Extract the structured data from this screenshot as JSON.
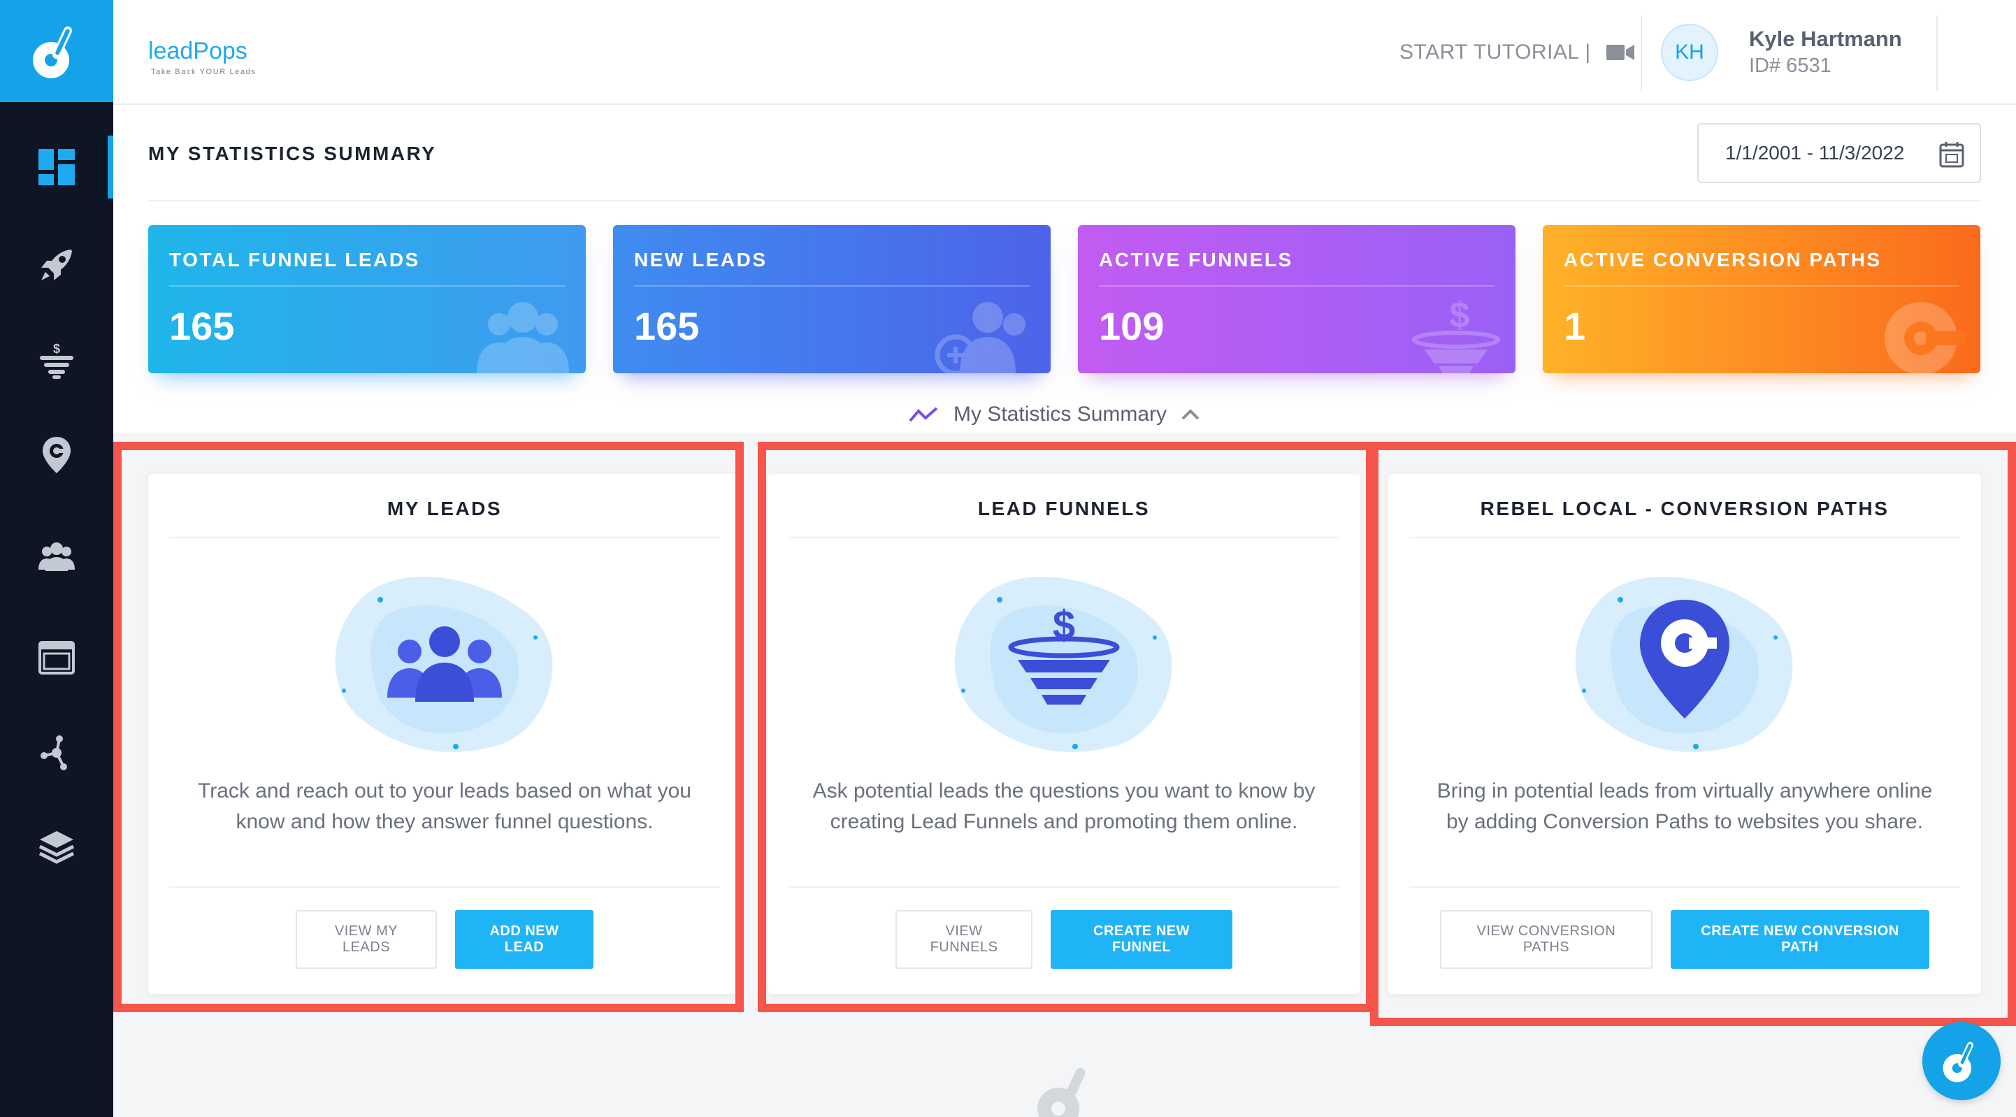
{
  "brand": {
    "name": "leadPops",
    "tagline": "Take Back YOUR Leads"
  },
  "header": {
    "tutorial_label": "START TUTORIAL |",
    "user": {
      "initials": "KH",
      "name": "Kyle Hartmann",
      "id_label": "ID# 6531"
    }
  },
  "sidebar": {
    "items": [
      {
        "icon": "dashboard-icon"
      },
      {
        "icon": "rocket-icon"
      },
      {
        "icon": "funnel-icon"
      },
      {
        "icon": "location-pin-icon"
      },
      {
        "icon": "users-icon"
      },
      {
        "icon": "window-icon"
      },
      {
        "icon": "network-icon"
      },
      {
        "icon": "layers-icon"
      }
    ]
  },
  "page": {
    "title": "MY STATISTICS SUMMARY",
    "date_range": "1/1/2001 - 11/3/2022",
    "summary_toggle": "My Statistics Summary"
  },
  "stats": [
    {
      "label": "TOTAL FUNNEL LEADS",
      "value": "165"
    },
    {
      "label": "NEW LEADS",
      "value": "165"
    },
    {
      "label": "ACTIVE FUNNELS",
      "value": "109"
    },
    {
      "label": "ACTIVE CONVERSION PATHS",
      "value": "1"
    }
  ],
  "features": [
    {
      "title": "MY LEADS",
      "description": "Track and reach out to your leads based on what you know and how they answer funnel questions.",
      "secondary_button": "VIEW MY LEADS",
      "primary_button": "ADD NEW LEAD"
    },
    {
      "title": "LEAD FUNNELS",
      "description": "Ask potential leads the questions you want to know by creating Lead Funnels and promoting them online.",
      "secondary_button": "VIEW FUNNELS",
      "primary_button": "CREATE NEW FUNNEL"
    },
    {
      "title": "REBEL LOCAL - CONVERSION PATHS",
      "description": "Bring in potential leads from virtually anywhere online by adding Conversion Paths to websites you share.",
      "secondary_button": "VIEW CONVERSION PATHS",
      "primary_button": "CREATE NEW CONVERSION PATH"
    }
  ],
  "colors": {
    "accent": "#14a3e8",
    "sidebar_bg": "#0e1626",
    "highlight_box": "#f5554a",
    "primary_button": "#1fb4f5"
  }
}
